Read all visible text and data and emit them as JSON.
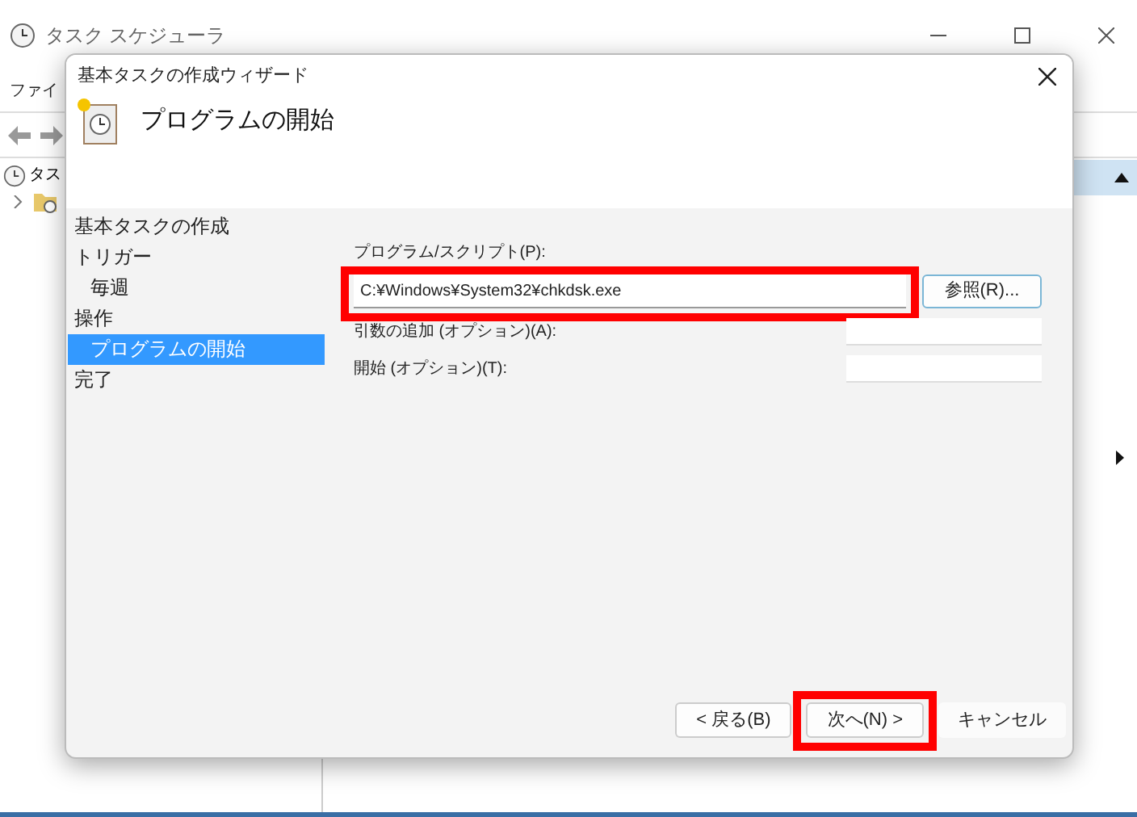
{
  "app": {
    "title": "タスク スケジューラ",
    "menu": [
      "ファイ"
    ],
    "tree": [
      {
        "label": "タス"
      }
    ]
  },
  "dialog": {
    "title": "基本タスクの作成ウィザード",
    "heading": "プログラムの開始",
    "steps": [
      {
        "label": "基本タスクの作成",
        "selected": false
      },
      {
        "label": "トリガー",
        "selected": false,
        "children": [
          {
            "label": "毎週",
            "selected": false
          }
        ]
      },
      {
        "label": "操作",
        "selected": false,
        "children": [
          {
            "label": "プログラムの開始",
            "selected": true
          }
        ]
      },
      {
        "label": "完了",
        "selected": false
      }
    ],
    "fields": [
      {
        "kind": "wide",
        "label": "プログラム/スクリプト(P):",
        "value": "C:¥Windows¥System32¥chkdsk.exe",
        "highlighted": true,
        "button": "参照(R)..."
      },
      {
        "kind": "short",
        "label": "引数の追加 (オプション)(A):",
        "highlighted": false
      },
      {
        "kind": "short",
        "label": "開始 (オプション)(T):",
        "highlighted": false
      }
    ],
    "buttons": [
      {
        "label": "< 戻る(B)",
        "highlighted": false
      },
      {
        "label": "次へ(N) >",
        "highlighted": true
      },
      {
        "label": "キャンセル",
        "highlighted": false,
        "kind": "flat"
      }
    ]
  }
}
